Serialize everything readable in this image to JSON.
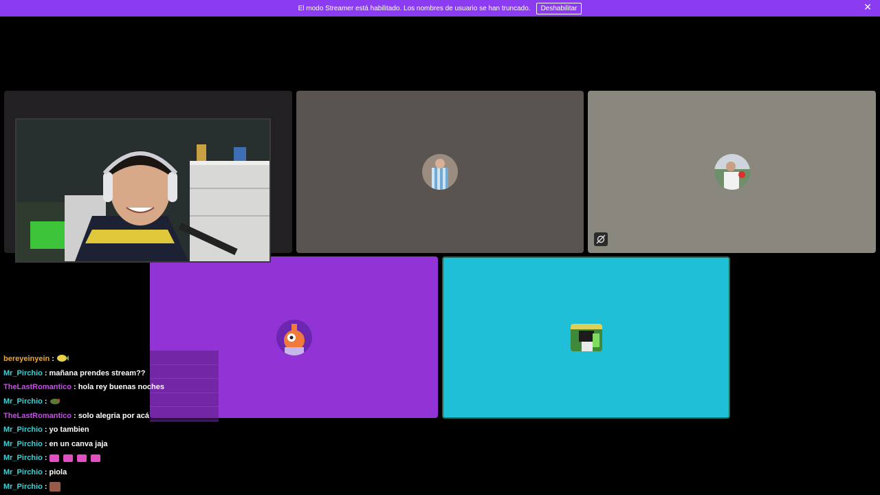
{
  "banner": {
    "message": "El modo Streamer está habilitado. Los nombres de usuario se han truncado.",
    "button_label": "Deshabilitar",
    "close_symbol": "✕",
    "color": "#8b3cf1"
  },
  "tiles": [
    {
      "name": "participant-tile-1",
      "bg": "#232023"
    },
    {
      "name": "participant-tile-2",
      "bg": "#5a5450"
    },
    {
      "name": "participant-tile-3",
      "bg": "#8a877f",
      "badge_icon": "video-off-icon"
    },
    {
      "name": "participant-tile-4",
      "bg": "#9233d6"
    },
    {
      "name": "participant-tile-5",
      "bg": "#1fbfd8",
      "border": "#1e6a5a"
    }
  ],
  "chat": {
    "messages": [
      {
        "user": "bereyeinyein",
        "color": "#e8a93a",
        "text": "",
        "emotes": [
          "emote-fish"
        ]
      },
      {
        "user": "Mr_Pirchio",
        "color": "#41d1d6",
        "text": "mañana prendes stream??",
        "emotes": []
      },
      {
        "user": "TheLastRomantico",
        "color": "#c44fe6",
        "text": "hola rey buenas noches",
        "emotes": []
      },
      {
        "user": "Mr_Pirchio",
        "color": "#41d1d6",
        "text": "",
        "emotes": [
          "emote-turtle"
        ]
      },
      {
        "user": "TheLastRomantico",
        "color": "#c44fe6",
        "text": "solo alegria por acá",
        "emotes": []
      },
      {
        "user": "Mr_Pirchio",
        "color": "#41d1d6",
        "text": "yo tambien",
        "emotes": []
      },
      {
        "user": "Mr_Pirchio",
        "color": "#41d1d6",
        "text": "en un canva jaja",
        "emotes": []
      },
      {
        "user": "Mr_Pirchio",
        "color": "#41d1d6",
        "text": "",
        "emotes": [
          "emote-bow",
          "emote-bow",
          "emote-bow",
          "emote-bow"
        ]
      },
      {
        "user": "Mr_Pirchio",
        "color": "#41d1d6",
        "text": "piola",
        "emotes": []
      },
      {
        "user": "Mr_Pirchio",
        "color": "#41d1d6",
        "text": "",
        "emotes": [
          "emote-face"
        ]
      }
    ]
  }
}
